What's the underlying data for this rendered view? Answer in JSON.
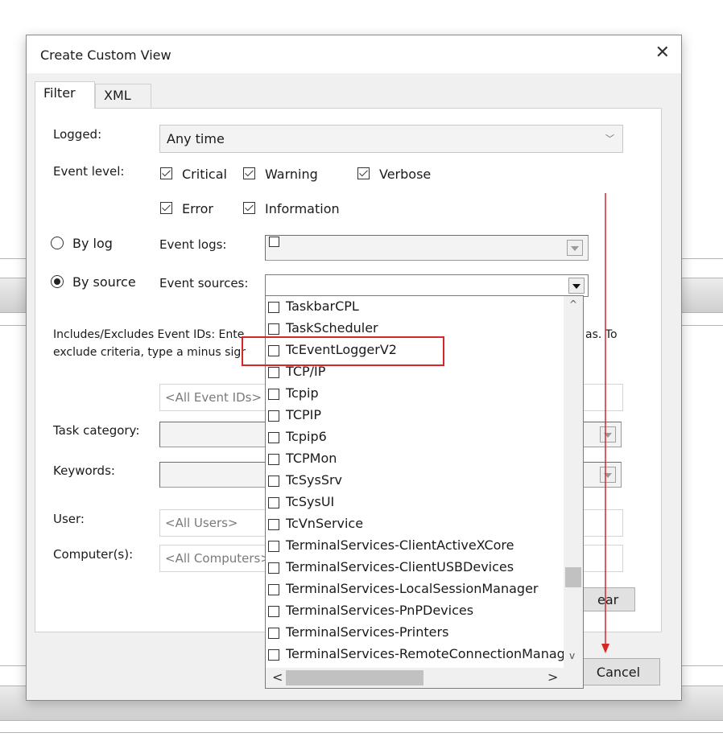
{
  "dialog": {
    "title": "Create Custom View",
    "close_glyph": "✕"
  },
  "tabs": [
    {
      "label": "Filter"
    },
    {
      "label": "XML"
    }
  ],
  "filter": {
    "logged_label": "Logged:",
    "logged_value": "Any time",
    "event_level_label": "Event level:",
    "levels": [
      {
        "label": "Critical",
        "checked": true
      },
      {
        "label": "Warning",
        "checked": true
      },
      {
        "label": "Verbose",
        "checked": true
      },
      {
        "label": "Error",
        "checked": true
      },
      {
        "label": "Information",
        "checked": true
      }
    ],
    "by_log_label": "By log",
    "event_logs_label": "Event logs:",
    "by_source_label": "By source",
    "event_sources_label": "Event sources:",
    "includes_text_1": "Includes/Excludes Event IDs: Ente",
    "includes_text_1_end": "as. To",
    "includes_text_2": "exclude criteria, type a minus sigr",
    "event_ids_placeholder": "<All Event IDs>",
    "task_category_label": "Task category:",
    "keywords_label": "Keywords:",
    "user_label": "User:",
    "user_placeholder": "<All Users>",
    "computers_label": "Computer(s):",
    "computers_placeholder": "<All Computers>",
    "clear_button_partial": "ear"
  },
  "buttons": {
    "cancel": "Cancel"
  },
  "dropdown": {
    "items": [
      "TaskbarCPL",
      "TaskScheduler",
      "TcEventLoggerV2",
      "TCP/IP",
      "Tcpip",
      "TCPIP",
      "Tcpip6",
      "TCPMon",
      "TcSysSrv",
      "TcSysUI",
      "TcVnService",
      "TerminalServices-ClientActiveXCore",
      "TerminalServices-ClientUSBDevices",
      "TerminalServices-LocalSessionManager",
      "TerminalServices-PnPDevices",
      "TerminalServices-Printers",
      "TerminalServices-RemoteConnectionManage"
    ],
    "highlighted_item": "TcEventLoggerV2"
  },
  "annotation_colors": {
    "highlight": "#d62727"
  }
}
